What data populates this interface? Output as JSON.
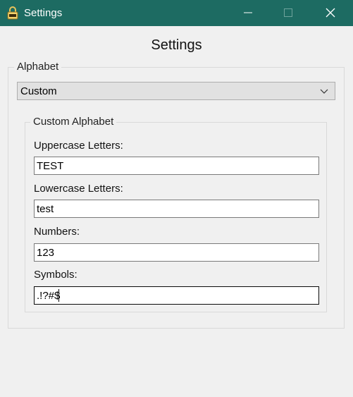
{
  "window": {
    "title": "Settings",
    "controls": {
      "minimize": "minimize-icon",
      "maximize": "maximize-icon",
      "close": "close-icon"
    },
    "accent_color": "#1d6b62"
  },
  "heading": "Settings",
  "alphabet_group": {
    "legend": "Alphabet",
    "selected": "Custom"
  },
  "custom_group": {
    "legend": "Custom Alphabet",
    "fields": {
      "uppercase": {
        "label": "Uppercase Letters:",
        "value": "TEST"
      },
      "lowercase": {
        "label": "Lowercase Letters:",
        "value": "test"
      },
      "numbers": {
        "label": "Numbers:",
        "value": "123"
      },
      "symbols": {
        "label": "Symbols:",
        "value": ".!?#$"
      }
    }
  }
}
